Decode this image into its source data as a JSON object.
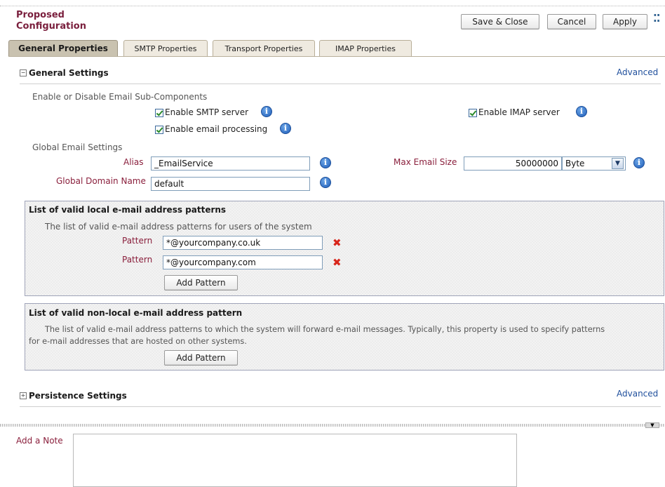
{
  "header": {
    "title_line1": "Proposed",
    "title_line2": "Configuration",
    "save_close_label": "Save & Close",
    "cancel_label": "Cancel",
    "apply_label": "Apply"
  },
  "tabs": [
    {
      "label": "General Properties",
      "active": true
    },
    {
      "label": "SMTP Properties",
      "active": false
    },
    {
      "label": "Transport Properties",
      "active": false
    },
    {
      "label": "IMAP Properties",
      "active": false
    }
  ],
  "general_settings": {
    "title": "General Settings",
    "advanced_label": "Advanced",
    "subcomponents_label": "Enable or Disable Email Sub-Components",
    "enable_smtp_label": "Enable SMTP server",
    "enable_smtp_checked": true,
    "enable_imap_label": "Enable IMAP server",
    "enable_imap_checked": true,
    "enable_email_processing_label": "Enable email processing",
    "enable_email_processing_checked": true,
    "global_email_label": "Global Email Settings",
    "alias_label": "Alias",
    "alias_value": "_EmailService",
    "max_email_size_label": "Max Email Size",
    "max_email_size_value": "50000000",
    "max_email_size_unit": "Byte",
    "global_domain_label": "Global Domain Name",
    "global_domain_value": "default"
  },
  "local_patterns": {
    "title": "List of valid local e-mail address patterns",
    "description": "The list of valid e-mail address patterns for users of the system",
    "pattern_label": "Pattern",
    "patterns": [
      "*@yourcompany.co.uk",
      "*@yourcompany.com"
    ],
    "add_label": "Add Pattern"
  },
  "nonlocal_patterns": {
    "title": "List of valid non-local e-mail address pattern",
    "description_line1": "The list of valid e-mail address patterns to which the system will forward e-mail messages. Typically, this property is used to specify patterns",
    "description_line2": "for e-mail addresses that are hosted on other systems.",
    "add_label": "Add Pattern"
  },
  "persistence_settings": {
    "title": "Persistence Settings",
    "advanced_label": "Advanced"
  },
  "note": {
    "label": "Add a Note",
    "value": ""
  },
  "icons": {
    "info": "info-icon",
    "remove": "remove-x-icon",
    "collapse": "collapse-arrow-icon",
    "grip": "toolbar-grip-icon",
    "expand": "expand-icon"
  },
  "colors": {
    "title": "#7a1f3d",
    "required_label": "#8a1f3c",
    "link": "#1f4f9c",
    "remove": "#d8261b"
  }
}
